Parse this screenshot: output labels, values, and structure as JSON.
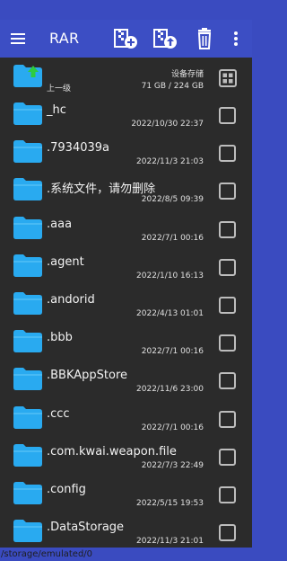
{
  "toolbar": {
    "title": "RAR",
    "icons": [
      "menu-icon",
      "add-archive-icon",
      "extract-archive-icon",
      "delete-icon",
      "more-vert-icon"
    ]
  },
  "up_row": {
    "label": "上一级",
    "storage_label": "设备存储",
    "storage_size": "71 GB / 224 GB",
    "view_toggle_icon": "grid-view-icon"
  },
  "files": [
    {
      "name": "_hc",
      "date": "2022/10/30 22:37"
    },
    {
      "name": ".7934039a",
      "date": "2022/11/3 21:03"
    },
    {
      "name": ".系统文件，请勿删除",
      "date": "2022/8/5 09:39"
    },
    {
      "name": ".aaa",
      "date": "2022/7/1 00:16"
    },
    {
      "name": ".agent",
      "date": "2022/1/10 16:13"
    },
    {
      "name": ".andorid",
      "date": "2022/4/13 01:01"
    },
    {
      "name": ".bbb",
      "date": "2022/7/1 00:16"
    },
    {
      "name": ".BBKAppStore",
      "date": "2022/11/6 23:00"
    },
    {
      "name": ".ccc",
      "date": "2022/7/1 00:16"
    },
    {
      "name": ".com.kwai.weapon.file",
      "date": "2022/7/3 22:49"
    },
    {
      "name": ".config",
      "date": "2022/5/15 19:53"
    },
    {
      "name": ".DataStorage",
      "date": "2022/11/3 21:01"
    }
  ],
  "footer": {
    "path": "/storage/emulated/0"
  },
  "colors": {
    "accent": "#3c4ec4",
    "folder": "#29aaf0",
    "background": "#2b2b2b",
    "up_arrow": "#2ecc40"
  }
}
